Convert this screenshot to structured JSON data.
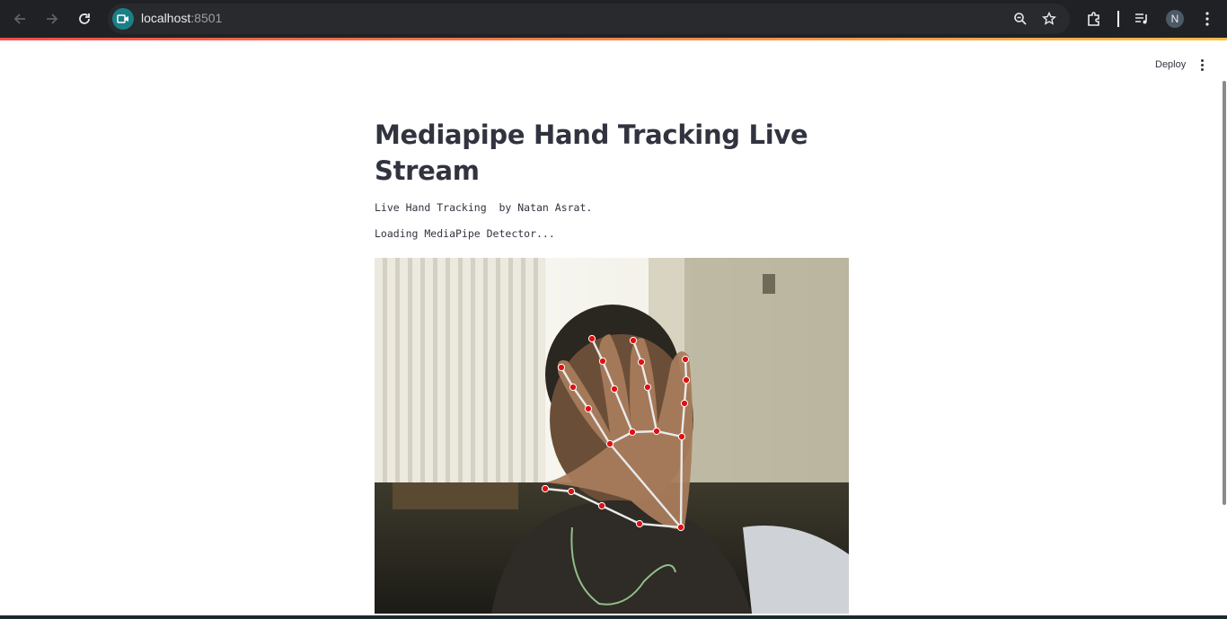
{
  "browser": {
    "url_host": "localhost",
    "url_port": ":8501",
    "profile_initial": "N",
    "icons": {
      "back": "arrow-left-icon",
      "forward": "arrow-right-icon",
      "reload": "reload-icon",
      "site": "video-camera-icon",
      "zoom": "zoom-icon",
      "bookmark": "star-icon",
      "extensions": "puzzle-icon",
      "media": "media-control-icon",
      "menu": "kebab-menu-icon"
    }
  },
  "app": {
    "deploy_label": "Deploy",
    "title": "Mediapipe Hand Tracking Live Stream",
    "subtitle": "Live Hand Tracking  by Natan Asrat.",
    "status": "Loading MediaPipe Detector...",
    "accent_colors": [
      "#ff4b4b",
      "#ffbd45"
    ]
  },
  "video_feed": {
    "description_icon": "webcam-frame",
    "landmark_color": "#e01010",
    "connection_color": "#e8e8e8"
  }
}
